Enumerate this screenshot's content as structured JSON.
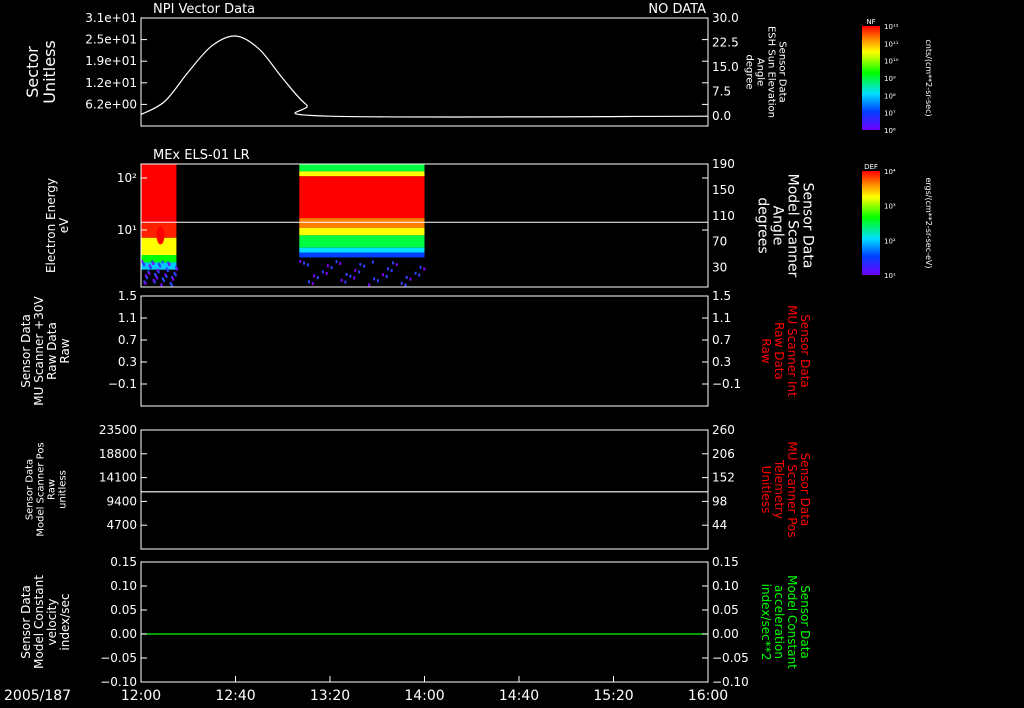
{
  "date_label": "2005/187",
  "x_ticks": [
    "12:00",
    "12:40",
    "13:20",
    "14:00",
    "14:40",
    "15:20",
    "16:00"
  ],
  "chart_data": [
    {
      "type": "line",
      "title": "NPI Vector Data",
      "status": "NO DATA",
      "ylabel_left": [
        "Sector",
        "Unitless"
      ],
      "yticks_left": [
        "3.1e+01",
        "2.5e+01",
        "1.9e+01",
        "1.2e+01",
        "6.2e+00"
      ],
      "ylabel_right": [
        "Sensor Data",
        "ESH Sun Elevation",
        "Angle",
        "degree"
      ],
      "yticks_right": [
        "30.0",
        "22.5",
        "15.0",
        "7.5",
        "0.0"
      ],
      "ylim_right": [
        -3,
        30
      ],
      "series": [
        {
          "color": "#ffffff",
          "x": [
            "12:00",
            "12:10",
            "12:20",
            "12:30",
            "12:40",
            "12:50",
            "13:00",
            "13:10",
            "13:20",
            "16:00"
          ],
          "y": [
            0.5,
            4.5,
            13.5,
            21.5,
            24.5,
            20.5,
            11.5,
            3.5,
            0.0,
            0.0
          ]
        }
      ]
    },
    {
      "type": "heatmap",
      "title": "MEx ELS-01 LR",
      "ylabel_left": [
        "Electron Energy",
        "eV"
      ],
      "yticks_left": [
        "10²",
        "10¹"
      ],
      "ylabel_right": [
        "Sensor Data",
        "Model Scanner",
        "Angle",
        "degrees"
      ],
      "yticks_right": [
        "190",
        "150",
        "110",
        "70",
        "30"
      ],
      "ylim_right": [
        0,
        190
      ],
      "data_intervals": [
        {
          "start": "12:00",
          "end": "12:15"
        },
        {
          "start": "13:07",
          "end": "14:00"
        }
      ],
      "overlay_line": {
        "color": "#ffffff",
        "value": 100
      },
      "colorbar": {
        "label": "DEF",
        "unit": "ergs/(cm**2-sr-sec-eV)",
        "ticks": [
          "10⁴",
          "10³",
          "10²",
          "10¹"
        ]
      }
    },
    {
      "type": "line",
      "ylabel_left": [
        "Sensor Data",
        "MU Scanner +30V",
        "Raw Data",
        "Raw"
      ],
      "yticks_left": [
        "1.5",
        "1.1",
        "0.7",
        "0.3",
        "−0.1"
      ],
      "ylabel_right": [
        "Sensor Data",
        "MU Scanner Int",
        "Raw Data",
        "Raw"
      ],
      "yticks_right": [
        "1.5",
        "1.1",
        "0.7",
        "0.3",
        "−0.1"
      ],
      "right_label_color": "#ff0000",
      "series": []
    },
    {
      "type": "line",
      "ylabel_left": [
        "Sensor Data",
        "Model Scanner Pos",
        "Raw",
        "unitless"
      ],
      "yticks_left": [
        "23500",
        "18800",
        "14100",
        "9400",
        "4700"
      ],
      "ylabel_right": [
        "Sensor Data",
        "MU Scanner Pos",
        "Telemetry",
        "Unitless"
      ],
      "yticks_right": [
        "260",
        "206",
        "152",
        "98",
        "44"
      ],
      "right_label_color": "#ff0000",
      "series": [
        {
          "color": "#ffffff",
          "x": [
            "12:00",
            "16:00"
          ],
          "y": [
            11300,
            11300
          ]
        }
      ]
    },
    {
      "type": "line",
      "ylabel_left": [
        "Sensor Data",
        "Model Constant",
        "velocity",
        "index/sec"
      ],
      "yticks_left": [
        "0.15",
        "0.10",
        "0.05",
        "0.00",
        "−0.05",
        "−0.10"
      ],
      "ylabel_right": [
        "Sensor Data",
        "Model Constant",
        "acceleration",
        "index/sec**2"
      ],
      "yticks_right": [
        "0.15",
        "0.10",
        "0.05",
        "0.00",
        "−0.05",
        "−0.10"
      ],
      "right_label_color": "#00ff00",
      "series": [
        {
          "color": "#00ff00",
          "x": [
            "12:00",
            "16:00"
          ],
          "y": [
            0.0,
            0.0
          ]
        }
      ]
    }
  ],
  "colorbar_top": {
    "label": "NF",
    "unit": "cnts/(cm**2-sr-sec)",
    "ticks": [
      "10¹²",
      "10¹¹",
      "10¹⁰",
      "10⁹",
      "10⁸",
      "10⁷",
      "10⁶"
    ]
  }
}
